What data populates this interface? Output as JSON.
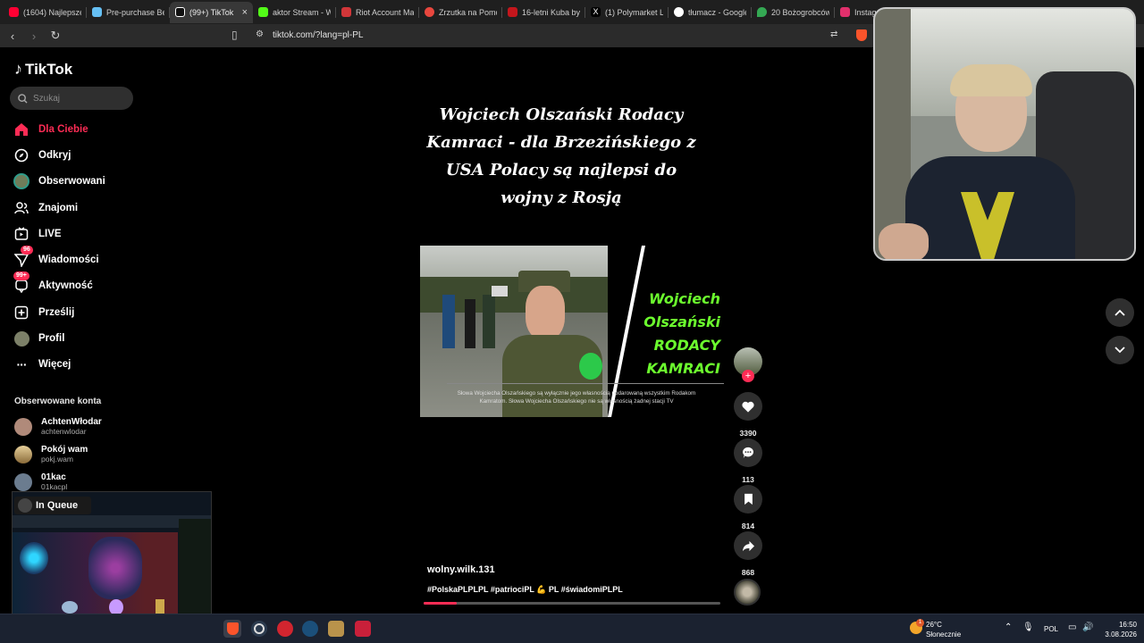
{
  "browser": {
    "tabs": [
      {
        "title": "(1604) Najlepsze",
        "color": "#ff0033"
      },
      {
        "title": "Pre-purchase Be",
        "color": "#66c0f4"
      },
      {
        "title": "(99+) TikTok",
        "color": "#ffffff",
        "active": true
      },
      {
        "title": "aktor Stream - W",
        "color": "#53fc18"
      },
      {
        "title": "Riot Account Ma",
        "color": "#d13639"
      },
      {
        "title": "Zrzutka na Pomo",
        "color": "#e8473e"
      },
      {
        "title": "16-letni Kuba by",
        "color": "#c4161c"
      },
      {
        "title": "(1) Polymarket Lo",
        "color": "#e7e7e7"
      },
      {
        "title": "tłumacz - Google",
        "color": "#4285f4"
      },
      {
        "title": "20 Bożogrobców",
        "color": "#34a853"
      },
      {
        "title": "Instagram",
        "color": "#e1306c"
      }
    ],
    "url": "tiktok.com/?lang=pl-PL"
  },
  "sidebar": {
    "logo": "TikTok",
    "search_placeholder": "Szukaj",
    "nav": [
      {
        "label": "Dla Ciebie",
        "icon": "home-icon",
        "active": true
      },
      {
        "label": "Odkryj",
        "icon": "compass-icon"
      },
      {
        "label": "Obserwowani",
        "icon": "following-avatar-icon"
      },
      {
        "label": "Znajomi",
        "icon": "friends-icon"
      },
      {
        "label": "LIVE",
        "icon": "live-icon"
      },
      {
        "label": "Wiadomości",
        "icon": "messages-icon",
        "badge": "96"
      },
      {
        "label": "Aktywność",
        "icon": "activity-icon",
        "badge": "99+"
      },
      {
        "label": "Prześlij",
        "icon": "upload-icon"
      },
      {
        "label": "Profil",
        "icon": "profile-icon"
      },
      {
        "label": "Więcej",
        "icon": "more-icon"
      }
    ],
    "following_header": "Obserwowane konta",
    "accounts": [
      {
        "name": "AchtenWłodar",
        "handle": "achtenwlodar",
        "color": "#b08a7a"
      },
      {
        "name": "Pokój wam",
        "handle": "pokj.wam",
        "color": "#c7a35a"
      },
      {
        "name": "01kac",
        "handle": "01kacpl",
        "color": "#6b7c8f"
      }
    ]
  },
  "overlay": {
    "queue_label": "In Queue"
  },
  "video": {
    "title": "Wojciech Olszański Rodacy Kamraci - dla Brzezińskiego z USA Polacy są najlepsi do wojny z Rosją",
    "overlay_text": "Wojciech Olszański RODACY KAMRACI",
    "caption": "Słowa Wojciecha Olszańskiego są wyłącznie jego własnością podarowaną wszystkim Rodakom Kamratom. Słowa Wojciecha Olszańskiego nie są własnością żadnej stacji TV",
    "username": "wolny.wilk.131",
    "hashtags": "#PolskaPLPLPL #patriociPL 💪 PL #świadomiPLPL",
    "progress": 0.11
  },
  "actions": {
    "likes": "3390",
    "comments": "113",
    "bookmarks": "814",
    "shares": "868"
  },
  "taskbar": {
    "weather_temp": "26°C",
    "weather_desc": "Słonecznie",
    "weather_badge": "1",
    "language": "POL",
    "time": "16:50",
    "date": "3.08.2026"
  },
  "colors": {
    "accent": "#fe2c55",
    "green_text": "#6cff2e"
  }
}
